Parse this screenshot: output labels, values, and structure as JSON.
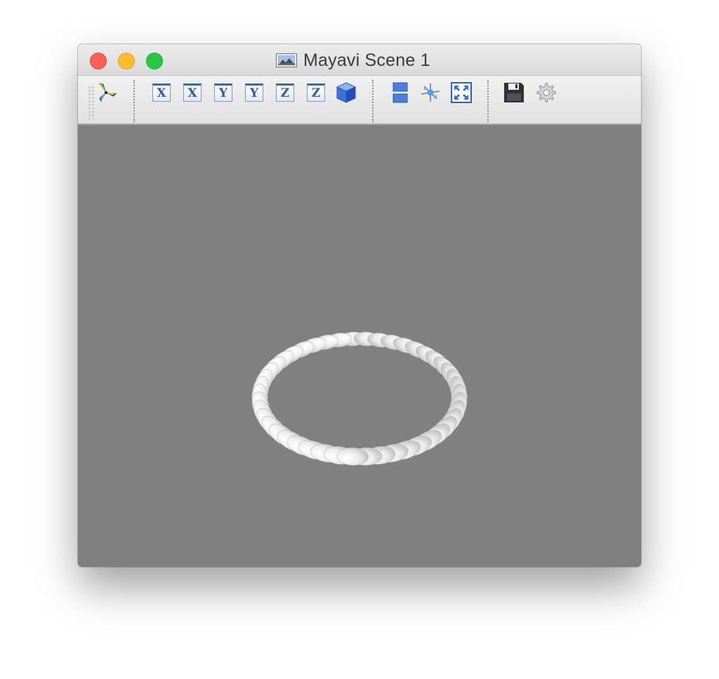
{
  "window": {
    "title": "Mayavi Scene 1",
    "title_icon": "scene-image-icon"
  },
  "toolbar": {
    "groups": [
      {
        "name": "mayavi",
        "icons": [
          "mayavi-logo-icon"
        ]
      },
      {
        "name": "views",
        "icons": [
          "view-x-icon",
          "view-x-reverse-icon",
          "view-y-icon",
          "view-y-reverse-icon",
          "view-z-icon",
          "view-z-reverse-icon",
          "isometric-cube-icon"
        ]
      },
      {
        "name": "scene",
        "icons": [
          "split-panels-icon",
          "axes-indicator-icon",
          "full-screen-icon"
        ]
      },
      {
        "name": "file",
        "icons": [
          "save-floppy-icon",
          "settings-gear-icon"
        ]
      }
    ],
    "axis_labels": [
      "X",
      "X",
      "Y",
      "Y",
      "Z",
      "Z"
    ]
  },
  "scene": {
    "background_color": "#808080",
    "object": "torus",
    "object_color": "#f2f2f2",
    "segments": 46
  },
  "colors": {
    "close": "#fc5f57",
    "minimize": "#fdbc2e",
    "zoom": "#28c840",
    "accent": "#3b68b6"
  }
}
